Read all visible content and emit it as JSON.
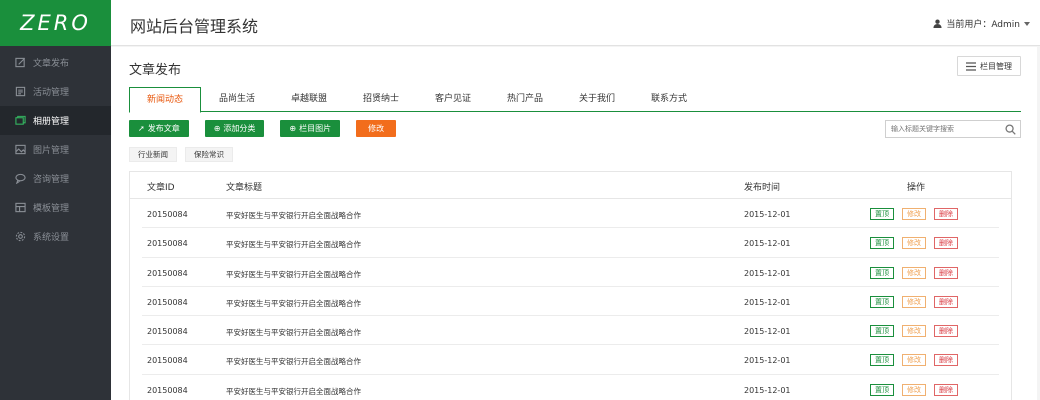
{
  "logo": "ZERO",
  "sidebar": {
    "items": [
      {
        "label": "文章发布",
        "icon": "edit-icon"
      },
      {
        "label": "活动管理",
        "icon": "calendar-icon"
      },
      {
        "label": "相册管理",
        "icon": "album-icon",
        "active": true
      },
      {
        "label": "图片管理",
        "icon": "image-icon"
      },
      {
        "label": "咨询管理",
        "icon": "chat-icon"
      },
      {
        "label": "模板管理",
        "icon": "template-icon"
      },
      {
        "label": "系统设置",
        "icon": "gear-icon"
      }
    ]
  },
  "header": {
    "title": "网站后台管理系统",
    "user_label": "当前用户：Admin"
  },
  "main": {
    "title": "文章发布",
    "column_manage": "栏目管理",
    "tabs": [
      "新闻动态",
      "品尚生活",
      "卓越联盟",
      "招贤纳士",
      "客户见证",
      "热门产品",
      "关于我们",
      "联系方式"
    ],
    "toolbar": {
      "publish": "发布文章",
      "add_category": "添加分类",
      "column_image": "栏目图片",
      "edit": "修改"
    },
    "search_placeholder": "输入标题关键字搜索",
    "subtabs": [
      "行业新闻",
      "保险常识"
    ],
    "table": {
      "headers": [
        "文章ID",
        "文章标题",
        "发布时间",
        "操作"
      ],
      "rows": [
        {
          "id": "20150084",
          "title": "平安好医生与平安银行开启全面战略合作",
          "date": "2015-12-01"
        },
        {
          "id": "20150084",
          "title": "平安好医生与平安银行开启全面战略合作",
          "date": "2015-12-01"
        },
        {
          "id": "20150084",
          "title": "平安好医生与平安银行开启全面战略合作",
          "date": "2015-12-01"
        },
        {
          "id": "20150084",
          "title": "平安好医生与平安银行开启全面战略合作",
          "date": "2015-12-01"
        },
        {
          "id": "20150084",
          "title": "平安好医生与平安银行开启全面战略合作",
          "date": "2015-12-01"
        },
        {
          "id": "20150084",
          "title": "平安好医生与平安银行开启全面战略合作",
          "date": "2015-12-01"
        },
        {
          "id": "20150084",
          "title": "平安好医生与平安银行开启全面战略合作",
          "date": "2015-12-01"
        }
      ],
      "ops": {
        "top": "置顶",
        "edit": "修改",
        "delete": "删除"
      }
    }
  },
  "colors": {
    "brand_green": "#1a8f3c",
    "accent_orange": "#f26d1c",
    "sidebar_bg": "#2e3238"
  }
}
